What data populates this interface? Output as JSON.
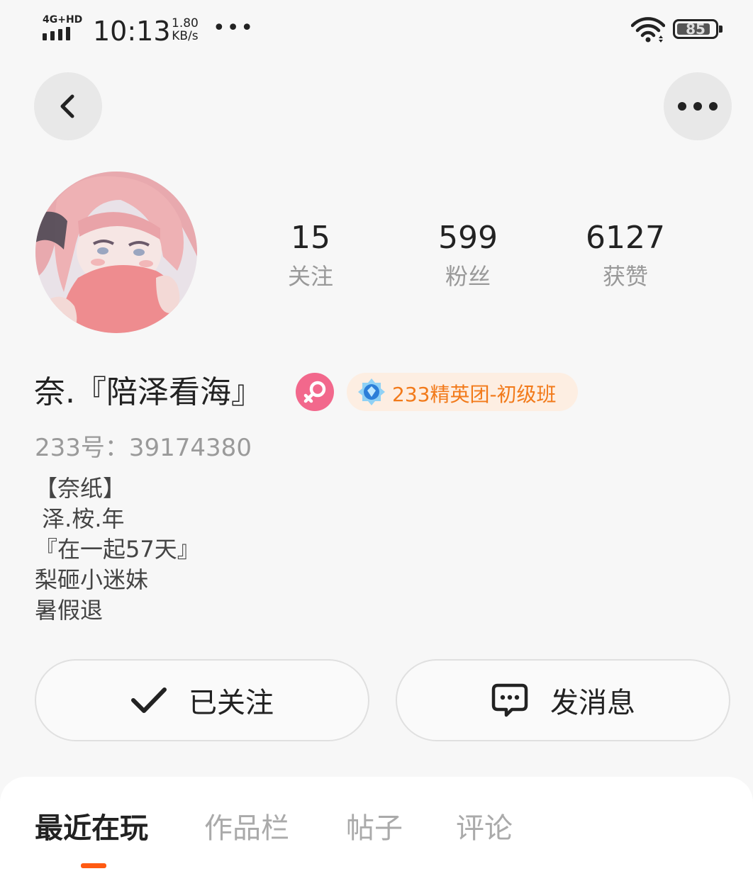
{
  "status_bar": {
    "network": "4G+HD",
    "time": "10:13",
    "speed_value": "1.80",
    "speed_unit": "KB/s",
    "battery": "85"
  },
  "profile": {
    "nickname": "奈.『陪泽看海』",
    "badge_label": "233精英团-初级班",
    "uid_label": "233号：39174380",
    "bio_lines": [
      "【奈纸】",
      " 泽.桉.年",
      "『在一起57天』",
      "梨砸小迷妹",
      "暑假退"
    ]
  },
  "stats": [
    {
      "value": "15",
      "label": "关注"
    },
    {
      "value": "599",
      "label": "粉丝"
    },
    {
      "value": "6127",
      "label": "获赞"
    }
  ],
  "actions": {
    "follow_label": "已关注",
    "message_label": "发消息"
  },
  "tabs": [
    {
      "label": "最近在玩",
      "active": true
    },
    {
      "label": "作品栏",
      "active": false
    },
    {
      "label": "帖子",
      "active": false
    },
    {
      "label": "评论",
      "active": false
    }
  ],
  "colors": {
    "accent": "#ff5a12",
    "gender_pink": "#f2688c",
    "badge_text": "#f27a1a"
  }
}
